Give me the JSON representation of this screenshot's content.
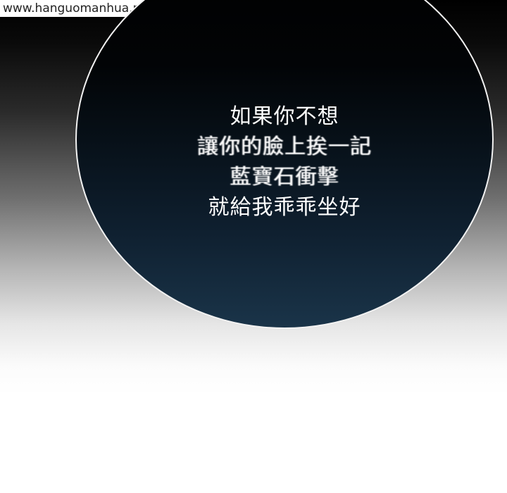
{
  "watermark": {
    "text": "www.hanguomanhua.me"
  },
  "speech_bubble": {
    "lines": [
      "如果你不想",
      "讓你的臉上挨一記",
      "藍寶石衝擊",
      "就給我乖乖坐好"
    ]
  },
  "colors": {
    "bubble_border": "#f2f2f2",
    "bubble_fill_top": "#000000",
    "bubble_fill_bottom": "#1a3449",
    "text": "#ffffff",
    "background_top": "#000000",
    "background_bottom": "#ffffff"
  }
}
